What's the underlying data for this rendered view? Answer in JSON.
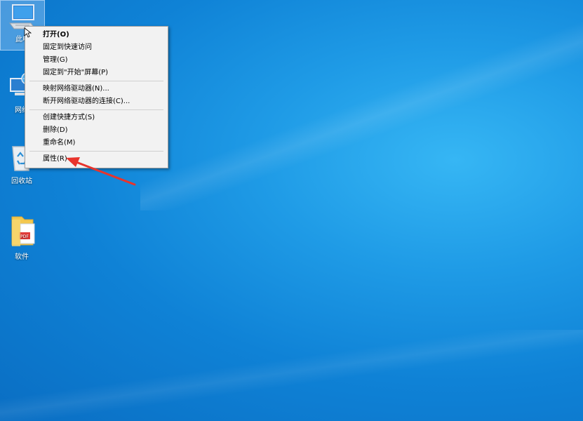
{
  "desktop": {
    "icons": [
      {
        "label": "此电",
        "icon": "computer-icon"
      },
      {
        "label": "网络",
        "icon": "network-icon"
      },
      {
        "label": "回收站",
        "icon": "recycle-bin-icon"
      },
      {
        "label": "软件",
        "icon": "folder-pdf-icon"
      }
    ]
  },
  "context_menu": {
    "items": [
      {
        "label": "打开(O)"
      },
      {
        "label": "固定到快速访问"
      },
      {
        "label": "管理(G)"
      },
      {
        "label": "固定到\"开始\"屏幕(P)"
      },
      {
        "label": "映射网络驱动器(N)..."
      },
      {
        "label": "断开网络驱动器的连接(C)..."
      },
      {
        "label": "创建快捷方式(S)"
      },
      {
        "label": "删除(D)"
      },
      {
        "label": "重命名(M)"
      },
      {
        "label": "属性(R)"
      }
    ]
  },
  "annotation": {
    "arrow_color": "#e8342c"
  },
  "colors": {
    "desktop_bg": "#1f9be6",
    "menu_bg": "#f2f2f2"
  }
}
